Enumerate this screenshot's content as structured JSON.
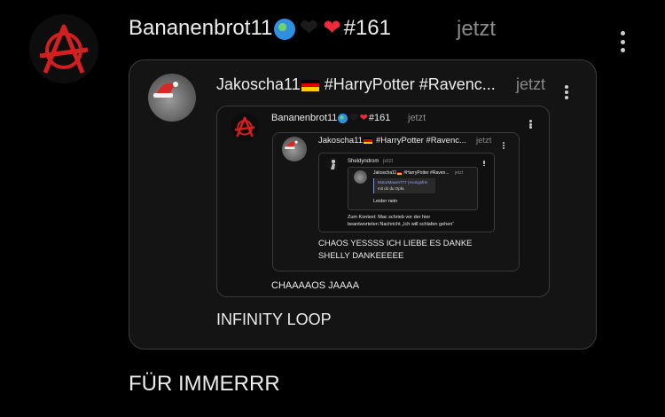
{
  "post": {
    "author": "Bananenbrot11",
    "author_suffix": "#161",
    "time": "jetzt",
    "text": "FÜR IMMERRR",
    "icons": [
      "globe-icon",
      "black-heart-icon",
      "red-heart-icon"
    ]
  },
  "quote1": {
    "author": "Jakoscha11",
    "author_tags": "#HarryPotter #Ravenc...",
    "time": "jetzt",
    "text": "INFINITY LOOP"
  },
  "quote2": {
    "author": "Bananenbrot11",
    "author_suffix": "#161",
    "time": "jetzt",
    "text": "CHAAAAOS JAAAA"
  },
  "quote3": {
    "author": "Jakoscha11",
    "author_tags": "#HarryPotter #Ravenc...",
    "time": "jetzt",
    "text_line1": "CHAOS YESSSS ICH LIEBE ES DANKE",
    "text_line2": "SHELLY DANKEEEEE"
  },
  "quote4": {
    "author": "Sheldyndrom",
    "time": "jetzt",
    "text_line1": "Zum Kontext: Mac schrieb vor der hier",
    "text_line2": "beantworteten Nachricht „Ich will schlafen gehen“"
  },
  "quote5": {
    "author": "Jakoscha11",
    "author_tags": "#HarryPotter #Raven...",
    "time": "jetzt",
    "reply_author": "MotorMaven777 | Kenigsfrei",
    "reply_text": "mit dir du Opfa",
    "text": "Leider nein"
  },
  "colors": {
    "background": "#000000",
    "card_border": "#3c3c3c",
    "anarchy_red": "#d31f1f",
    "time_gray": "#8a8a8a",
    "heart_red": "#ee2a3b"
  }
}
